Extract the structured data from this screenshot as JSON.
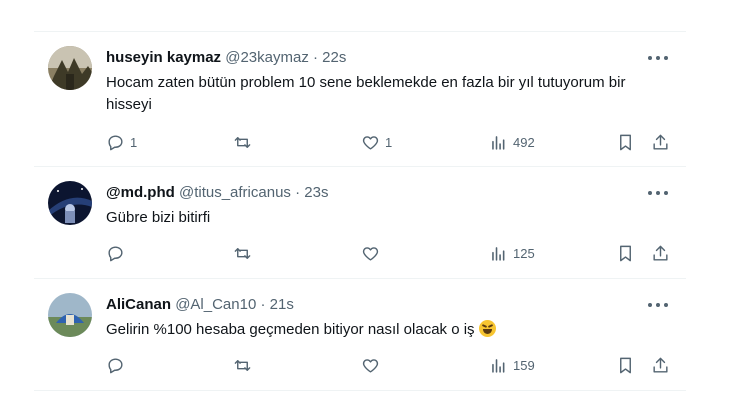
{
  "tweets": [
    {
      "name": "huseyin kaymaz",
      "handle": "@23kaymaz",
      "separator": "·",
      "time": "22s",
      "text": "Hocam zaten bütün problem 10 sene beklemekde  en fazla bir yıl tutuyorum bir hisseyi",
      "reply_count": "1",
      "retweet_count": "",
      "like_count": "1",
      "views": "492"
    },
    {
      "name": "@md.phd",
      "handle": "@titus_africanus",
      "separator": "·",
      "time": "23s",
      "text": "Gübre bizi bitirfi",
      "reply_count": "",
      "retweet_count": "",
      "like_count": "",
      "views": "125"
    },
    {
      "name": "AliCanan",
      "handle": "@Al_Can10",
      "separator": "·",
      "time": "21s",
      "text": "Gelirin %100 hesaba geçmeden bitiyor nasıl olacak o iş",
      "emoji": "rolling-on-floor-laughing-emoji",
      "reply_count": "",
      "retweet_count": "",
      "like_count": "",
      "views": "159"
    }
  ],
  "icons": {
    "reply": "reply-icon",
    "retweet": "retweet-icon",
    "like": "heart-icon",
    "views": "views-chart-icon",
    "bookmark": "bookmark-icon",
    "share": "share-icon",
    "more": "more-dots-icon"
  },
  "colors": {
    "text": "#0f1419",
    "secondary": "#536471",
    "divider": "#eff3f4"
  }
}
